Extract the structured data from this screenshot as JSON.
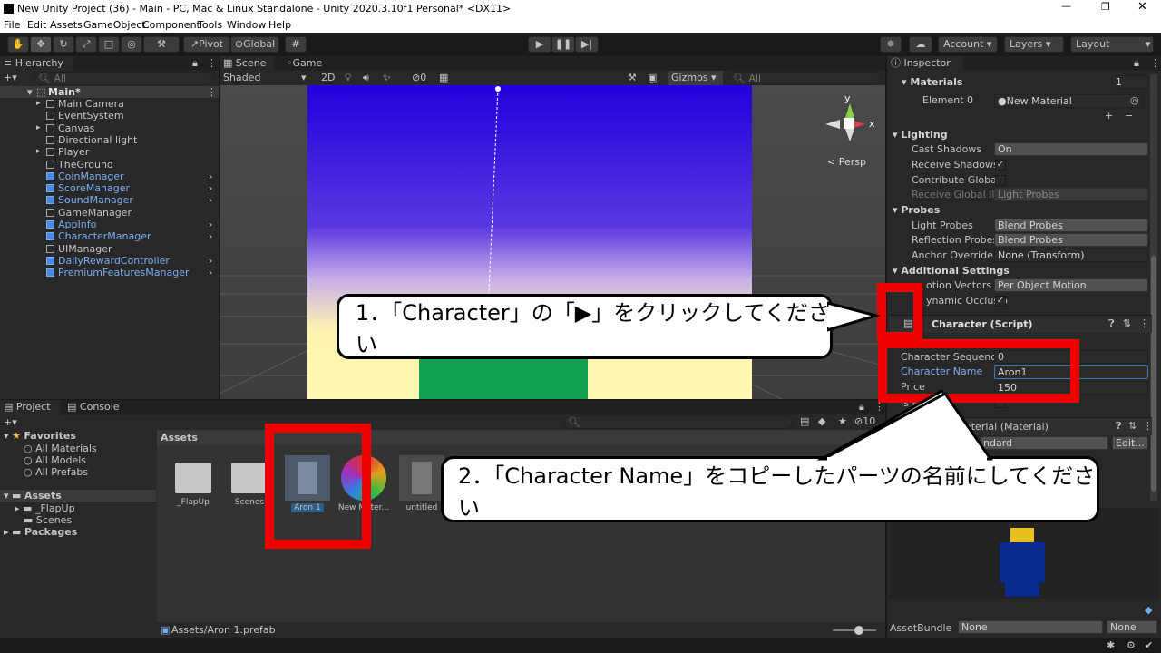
{
  "window": {
    "title": "New Unity Project (36) - Main - PC, Mac & Linux Standalone - Unity 2020.3.10f1 Personal* <DX11>"
  },
  "menu": [
    "File",
    "Edit",
    "Assets",
    "GameObject",
    "Component",
    "Tools",
    "Window",
    "Help"
  ],
  "toolbar": {
    "pivot": "Pivot",
    "global": "Global",
    "account": "Account",
    "layers": "Layers",
    "layout": "Layout"
  },
  "hierarchy": {
    "tab": "Hierarchy",
    "search_placeholder": "All",
    "scene": "Main*",
    "items": [
      {
        "label": "Main Camera",
        "prefab": false
      },
      {
        "label": "EventSystem",
        "prefab": false
      },
      {
        "label": "Canvas",
        "prefab": false
      },
      {
        "label": "Directional light",
        "prefab": false
      },
      {
        "label": "Player",
        "prefab": false
      },
      {
        "label": "TheGround",
        "prefab": false
      },
      {
        "label": "CoinManager",
        "prefab": true
      },
      {
        "label": "ScoreManager",
        "prefab": true
      },
      {
        "label": "SoundManager",
        "prefab": true
      },
      {
        "label": "GameManager",
        "prefab": false
      },
      {
        "label": "AppInfo",
        "prefab": true
      },
      {
        "label": "CharacterManager",
        "prefab": true
      },
      {
        "label": "UIManager",
        "prefab": false
      },
      {
        "label": "DailyRewardController",
        "prefab": true
      },
      {
        "label": "PremiumFeaturesManager",
        "prefab": true
      }
    ]
  },
  "scene_view": {
    "tab_scene": "Scene",
    "tab_game": "Game",
    "shading": "Shaded",
    "mode_2d": "2D",
    "hidden_count": "0",
    "gizmos": "Gizmos",
    "search_placeholder": "All",
    "persp": "< Persp",
    "axis_y": "y",
    "axis_x": "x"
  },
  "project": {
    "tab_project": "Project",
    "tab_console": "Console",
    "favorites": "Favorites",
    "favorite_items": [
      "All Materials",
      "All Models",
      "All Prefabs"
    ],
    "assets_root": "Assets",
    "asset_folders": [
      "_FlapUp",
      "Scenes"
    ],
    "packages": "Packages",
    "breadcrumb": "Assets",
    "grid_items": [
      "_FlapUp",
      "Scenes",
      "Aron 1",
      "New Mater...",
      "untitled"
    ],
    "status_path": "Assets/Aron 1.prefab",
    "hidden_count": "10"
  },
  "inspector": {
    "tab": "Inspector",
    "materials": "Materials",
    "materials_count": "1",
    "element0": "Element 0",
    "element0_value": "New Material",
    "lighting": "Lighting",
    "cast_shadows": "Cast Shadows",
    "cast_shadows_value": "On",
    "receive_shadows": "Receive Shadows",
    "contribute_gi": "Contribute Global I",
    "receive_gi": "Receive Global Illu",
    "receive_gi_value": "Light Probes",
    "probes": "Probes",
    "light_probes": "Light Probes",
    "light_probes_value": "Blend Probes",
    "reflection_probes": "Reflection Probes",
    "reflection_probes_value": "Blend Probes",
    "anchor_override": "Anchor Override",
    "anchor_override_value": "None (Transform)",
    "additional": "Additional Settings",
    "motion_vectors": "otion Vectors",
    "motion_vectors_value": "Per Object Motion",
    "dynamic_occlusion": "ynamic Occlusio",
    "script": "Character (Script)",
    "char_seq": "Character Sequence",
    "char_seq_value": "0",
    "char_name": "Character Name",
    "char_name_value": "Aron1",
    "price": "Price",
    "price_value": "150",
    "is_free": "Is Fr",
    "material_hdr": "aterial (Material)",
    "shader_value": "ndard",
    "edit_btn": "Edit...",
    "assetbundle": "AssetBundle",
    "assetbundle_value": "None",
    "assetbundle_variant": "None"
  },
  "callouts": {
    "step1": "1．「Character」の「▶」をクリックしてください",
    "step2": "2．「Character Name」をコピーしたパーツの名前にしてください"
  }
}
